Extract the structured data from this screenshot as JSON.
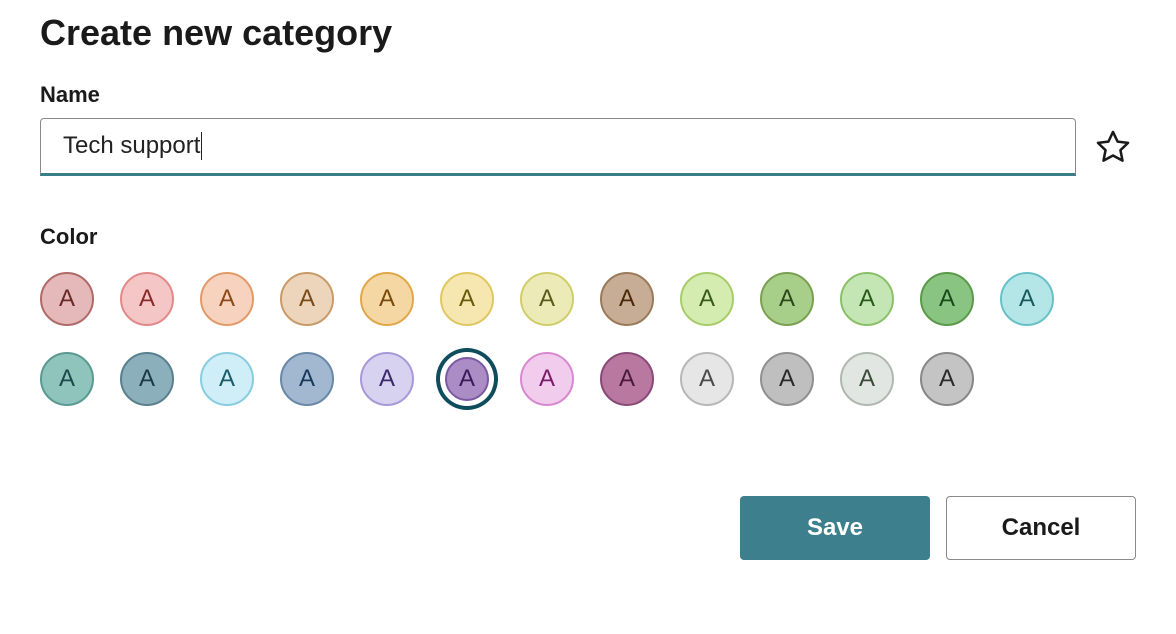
{
  "dialog": {
    "title": "Create new category",
    "name_label": "Name",
    "name_value": "Tech support",
    "color_label": "Color",
    "save_label": "Save",
    "cancel_label": "Cancel"
  },
  "swatch_letter": "A",
  "selected_color_index": 18,
  "colors": [
    {
      "fill": "#e5b9b9",
      "border": "#b06a6a",
      "text": "#6a2a2a"
    },
    {
      "fill": "#f4c6c6",
      "border": "#e28a8a",
      "text": "#8a2a2a"
    },
    {
      "fill": "#f7d3bf",
      "border": "#e29a6a",
      "text": "#8a4a1a"
    },
    {
      "fill": "#ecd5bb",
      "border": "#c99a6a",
      "text": "#7a4a1a"
    },
    {
      "fill": "#f5d7a3",
      "border": "#e0a84a",
      "text": "#7a4a0a"
    },
    {
      "fill": "#f6e6b0",
      "border": "#e0c860",
      "text": "#6a5a0a"
    },
    {
      "fill": "#ecebb8",
      "border": "#d0ce6a",
      "text": "#5a5a1a"
    },
    {
      "fill": "#c7ad95",
      "border": "#9a7a5a",
      "text": "#4a2a0a"
    },
    {
      "fill": "#d5ecb0",
      "border": "#a8cc6a",
      "text": "#3a5a1a"
    },
    {
      "fill": "#a7cf8a",
      "border": "#7aa050",
      "text": "#2a4a1a"
    },
    {
      "fill": "#c4e6b4",
      "border": "#8ac06a",
      "text": "#2a5a1a"
    },
    {
      "fill": "#8ac482",
      "border": "#5a9a4a",
      "text": "#1a4a1a"
    },
    {
      "fill": "#b4e6e8",
      "border": "#6ac0c8",
      "text": "#1a5a5a"
    },
    {
      "fill": "#8fc4bd",
      "border": "#5a9a90",
      "text": "#1a4a4a"
    },
    {
      "fill": "#8bb0bb",
      "border": "#5a8090",
      "text": "#1a3a4a"
    },
    {
      "fill": "#cfeef7",
      "border": "#8acde0",
      "text": "#1a5a6a"
    },
    {
      "fill": "#a2b8d0",
      "border": "#6a88a8",
      "text": "#1a3a5a"
    },
    {
      "fill": "#d6d2f0",
      "border": "#a89ad8",
      "text": "#3a2a6a"
    },
    {
      "fill": "#ab8cc4",
      "border": "#7a5aa0",
      "text": "#3a1a5a"
    },
    {
      "fill": "#f2ccec",
      "border": "#d88ad0",
      "text": "#7a1a6a"
    },
    {
      "fill": "#b878a0",
      "border": "#8a4a78",
      "text": "#4a1a3a"
    },
    {
      "fill": "#e6e6e6",
      "border": "#b8b8b8",
      "text": "#4a4a4a"
    },
    {
      "fill": "#bfbfbf",
      "border": "#909090",
      "text": "#2a2a2a"
    },
    {
      "fill": "#e2e6e2",
      "border": "#b0b8b0",
      "text": "#3a4a3a"
    },
    {
      "fill": "#c4c4c4",
      "border": "#888888",
      "text": "#2a2a2a"
    }
  ]
}
